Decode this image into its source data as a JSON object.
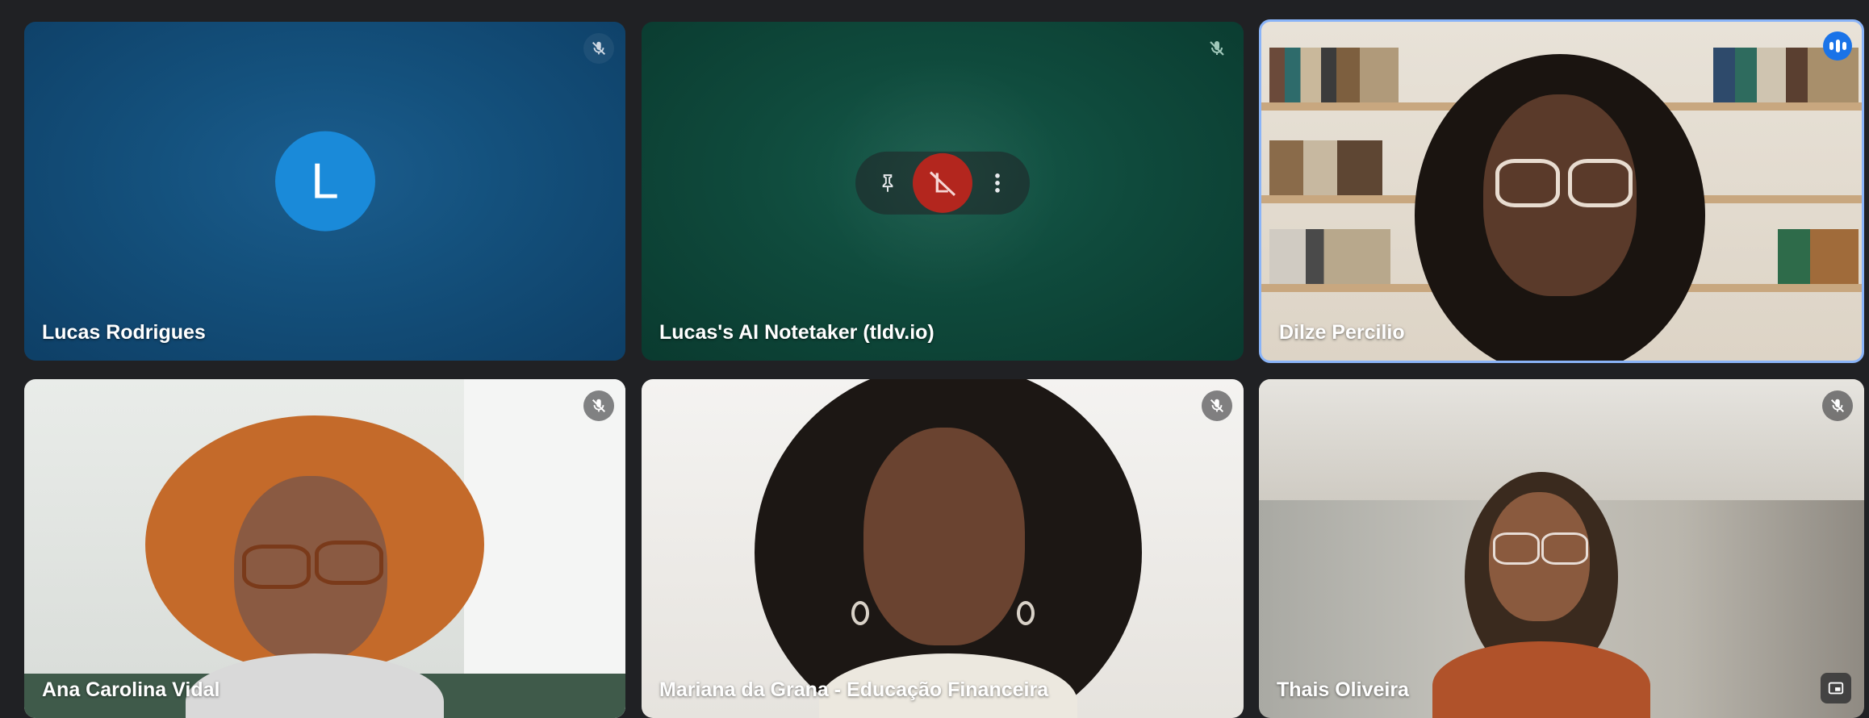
{
  "participants": [
    {
      "name": "Lucas Rodrigues",
      "avatar_letter": "L",
      "muted": true,
      "bg_color": "#14517d"
    },
    {
      "name": "Lucas's AI Notetaker (tldv.io)",
      "muted": true,
      "bg_color": "#0f4a3c"
    },
    {
      "name": "Dilze Percilio",
      "speaking": true,
      "highlight_color": "#8ab4f8"
    },
    {
      "name": "Ana Carolina Vidal",
      "muted": true
    },
    {
      "name": "Mariana da Grana - Educação Financeira",
      "muted": true
    },
    {
      "name": "Thais Oliveira",
      "muted": true
    }
  ],
  "hover_controls": {
    "pin_icon": "pin-icon",
    "center_icon": "remove-participant-icon",
    "more_icon": "more-options-icon"
  },
  "icons": {
    "mic": "mic-off-icon",
    "speaking": "speaking-indicator-icon",
    "expand": "expand-icon"
  }
}
